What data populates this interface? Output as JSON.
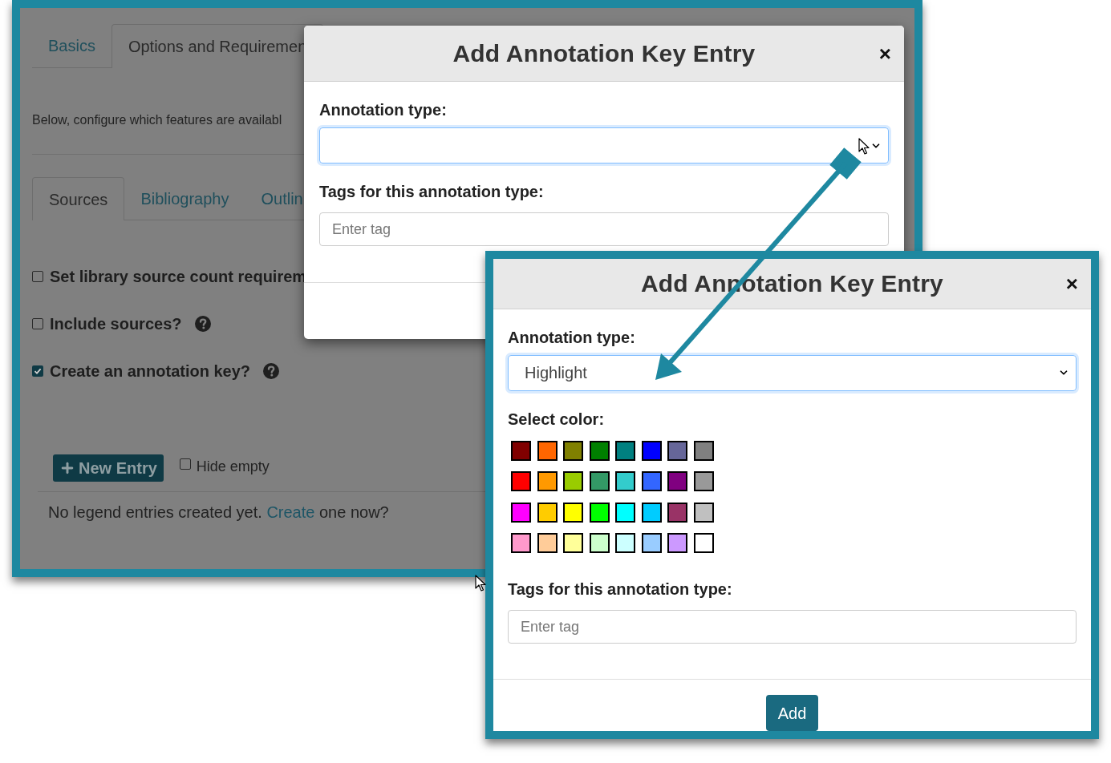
{
  "background_page": {
    "tabs": [
      {
        "label": "Basics",
        "selected": false
      },
      {
        "label": "Options and Requiremen",
        "selected": true
      }
    ],
    "intro": "Below, configure which features are availabl",
    "subtabs": [
      {
        "label": "Sources",
        "selected": true
      },
      {
        "label": "Bibliography",
        "selected": false
      },
      {
        "label": "Outlin",
        "selected": false
      }
    ],
    "options": [
      {
        "label": "Set library source count requirem",
        "checked": false,
        "help": false
      },
      {
        "label": "Include sources?",
        "checked": false,
        "help": true
      },
      {
        "label": "Create an annotation key?",
        "checked": true,
        "help": true
      }
    ],
    "new_entry_button": "New Entry",
    "hide_empty": {
      "label": "Hide empty",
      "checked": false
    },
    "empty_message": {
      "before": "No legend entries created yet.",
      "link": "Create",
      "after": "one now?"
    }
  },
  "dialog_before": {
    "title": "Add Annotation Key Entry",
    "close": "×",
    "type_label": "Annotation type:",
    "tags_label": "Tags for this annotation type:",
    "tags_placeholder": "Enter tag"
  },
  "dialog_after": {
    "title": "Add Annotation Key Entry",
    "close": "×",
    "type_label": "Annotation type:",
    "type_value": "Highlight",
    "color_label": "Select color:",
    "swatches": [
      {
        "color": "#800000"
      },
      {
        "color": "#ff6600"
      },
      {
        "color": "#808000"
      },
      {
        "color": "#008000"
      },
      {
        "color": "#008080"
      },
      {
        "color": "#0000ff"
      },
      {
        "color": "#666699"
      },
      {
        "color": "#808080"
      },
      {
        "color": "#ff0000"
      },
      {
        "color": "#ff9900"
      },
      {
        "color": "#99cc00"
      },
      {
        "color": "#339966"
      },
      {
        "color": "#33cccc"
      },
      {
        "color": "#3366ff"
      },
      {
        "color": "#800080"
      },
      {
        "color": "#999999"
      },
      {
        "color": "#ff00ff"
      },
      {
        "color": "#ffcc00"
      },
      {
        "color": "#ffff00"
      },
      {
        "color": "#00ff00"
      },
      {
        "color": "#00ffff"
      },
      {
        "color": "#00ccff"
      },
      {
        "color": "#993366"
      },
      {
        "color": "#c0c0c0"
      },
      {
        "color": "#ff99cc"
      },
      {
        "color": "#ffcc99"
      },
      {
        "color": "#ffff99"
      },
      {
        "color": "#ccffcc"
      },
      {
        "color": "#ccffff"
      },
      {
        "color": "#99ccff"
      },
      {
        "color": "#cc99ff"
      },
      {
        "color": "#ffffff"
      }
    ],
    "tags_label": "Tags for this annotation type:",
    "tags_placeholder": "Enter tag",
    "add_button": "Add"
  }
}
